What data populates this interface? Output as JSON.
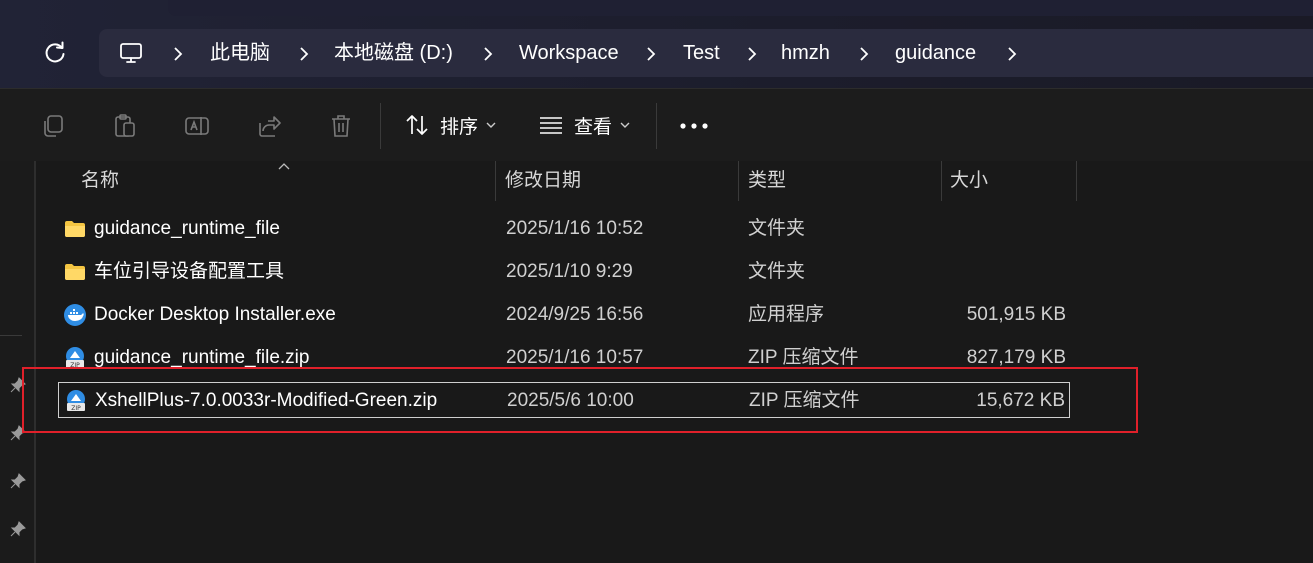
{
  "address": {
    "crumbs": [
      "此电脑",
      "本地磁盘 (D:)",
      "Workspace",
      "Test",
      "hmzh",
      "guidance"
    ]
  },
  "toolbar": {
    "sort_label": "排序",
    "view_label": "查看",
    "icons": [
      "copy-icon",
      "paste-icon",
      "rename-icon",
      "share-icon",
      "delete-icon"
    ]
  },
  "columns": {
    "name": "名称",
    "date": "修改日期",
    "type": "类型",
    "size": "大小"
  },
  "files": [
    {
      "name": "guidance_runtime_file",
      "date": "2025/1/16 10:52",
      "type": "文件夹",
      "size": "",
      "icon": "folder-icon"
    },
    {
      "name": "车位引导设备配置工具",
      "date": "2025/1/10 9:29",
      "type": "文件夹",
      "size": "",
      "icon": "folder-icon"
    },
    {
      "name": "Docker Desktop Installer.exe",
      "date": "2024/9/25 16:56",
      "type": "应用程序",
      "size": "501,915 KB",
      "icon": "docker-icon"
    },
    {
      "name": "guidance_runtime_file.zip",
      "date": "2025/1/16 10:57",
      "type": "ZIP 压缩文件",
      "size": "827,179 KB",
      "icon": "zip-icon"
    },
    {
      "name": "XshellPlus-7.0.0033r-Modified-Green.zip",
      "date": "2025/5/6 10:00",
      "type": "ZIP 压缩文件",
      "size": "15,672 KB",
      "icon": "zip-icon"
    }
  ],
  "colors": {
    "highlight": "#e0202a",
    "folder": "#f4c542",
    "accent": "#2f8de4"
  }
}
